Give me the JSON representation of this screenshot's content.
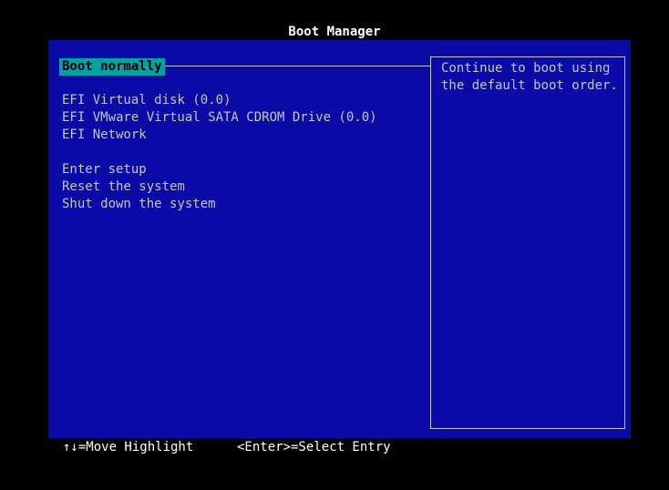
{
  "title": "Boot Manager",
  "menu": {
    "selected": "Boot normally",
    "devices": [
      "EFI Virtual disk (0.0)",
      "EFI VMware Virtual SATA CDROM Drive (0.0)",
      "EFI Network"
    ],
    "actions": [
      "Enter setup",
      "Reset the system",
      "Shut down the system"
    ]
  },
  "help": {
    "text": "Continue to boot using the default boot order."
  },
  "footer": {
    "move_hint": "↑↓=Move Highlight",
    "select_hint": "<Enter>=Select Entry"
  },
  "colors": {
    "background": "#0a0aa7",
    "highlight": "#00a3a3",
    "text": "#c6c6c6"
  }
}
